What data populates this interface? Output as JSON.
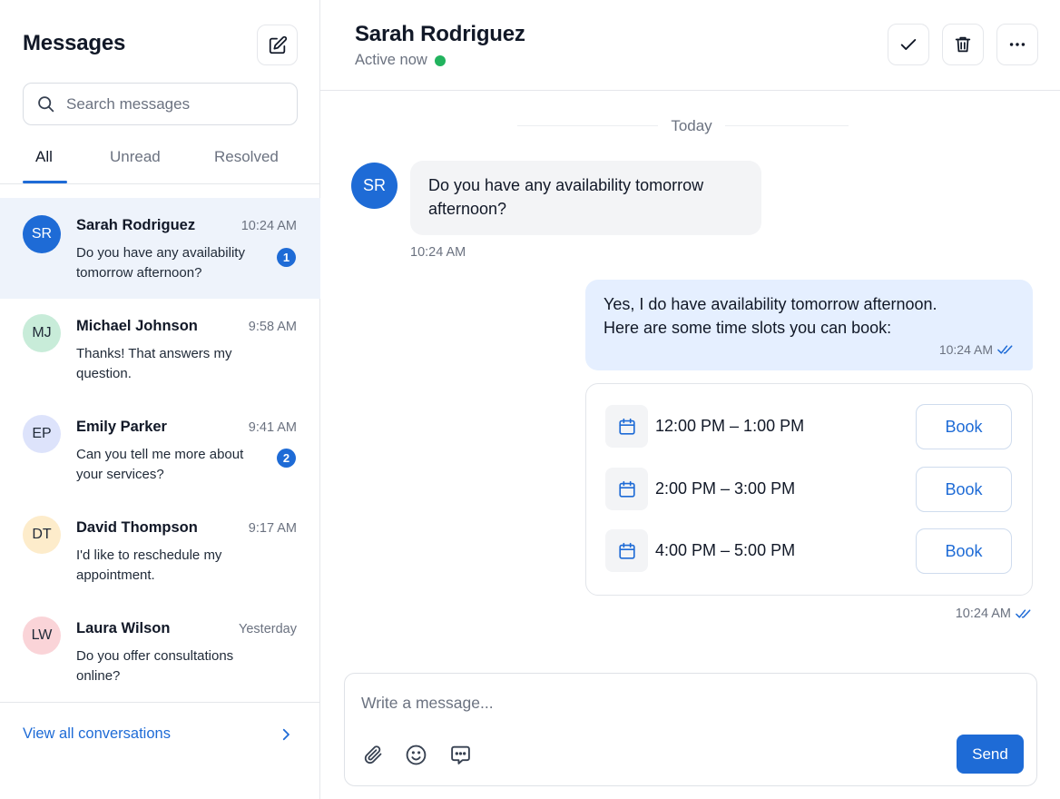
{
  "sidebar": {
    "title": "Messages",
    "search_placeholder": "Search messages",
    "tabs": [
      {
        "label": "All",
        "active": true
      },
      {
        "label": "Unread",
        "active": false
      },
      {
        "label": "Resolved",
        "active": false
      }
    ],
    "conversations": [
      {
        "initials": "SR",
        "name": "Sarah Rodriguez",
        "time": "10:24 AM",
        "preview": "Do you have any availability tomorrow afternoon?",
        "unread": "1",
        "selected": true,
        "avatar_bg": "#1e6bd6",
        "avatar_fg": "#ffffff"
      },
      {
        "initials": "MJ",
        "name": "Michael Johnson",
        "time": "9:58 AM",
        "preview": "Thanks! That answers my question.",
        "unread": "",
        "selected": false,
        "avatar_bg": "#c8ecd9",
        "avatar_fg": "#1f2937"
      },
      {
        "initials": "EP",
        "name": "Emily Parker",
        "time": "9:41 AM",
        "preview": "Can you tell me more about your services?",
        "unread": "2",
        "selected": false,
        "avatar_bg": "#dde3fb",
        "avatar_fg": "#1f2937"
      },
      {
        "initials": "DT",
        "name": "David Thompson",
        "time": "9:17 AM",
        "preview": "I'd like to reschedule my appointment.",
        "unread": "",
        "selected": false,
        "avatar_bg": "#fdeccb",
        "avatar_fg": "#1f2937"
      },
      {
        "initials": "LW",
        "name": "Laura Wilson",
        "time": "Yesterday",
        "preview": "Do you offer consultations online?",
        "unread": "",
        "selected": false,
        "avatar_bg": "#fad4d8",
        "avatar_fg": "#1f2937"
      }
    ],
    "view_all_label": "View all conversations"
  },
  "chat": {
    "contact_name": "Sarah Rodriguez",
    "status": "Active now",
    "day_label": "Today",
    "incoming": {
      "initials": "SR",
      "text": "Do you have any availability tomorrow afternoon?",
      "time": "10:24 AM"
    },
    "outgoing": {
      "text_line1": "Yes, I do have availability tomorrow afternoon.",
      "text_line2": "Here are some time slots you can book:",
      "time": "10:24 AM"
    },
    "slots": [
      {
        "label": "12:00 PM – 1:00 PM",
        "button": "Book"
      },
      {
        "label": "2:00 PM – 3:00 PM",
        "button": "Book"
      },
      {
        "label": "4:00 PM – 5:00 PM",
        "button": "Book"
      }
    ],
    "slots_time": "10:24 AM"
  },
  "composer": {
    "placeholder": "Write a message...",
    "send_label": "Send"
  },
  "icons": {
    "compose": "compose-icon",
    "search": "search-icon",
    "resolve": "check-icon",
    "delete": "trash-icon",
    "more": "more-horizontal-icon",
    "calendar": "calendar-icon",
    "read_receipt": "double-check-icon",
    "attach": "paperclip-icon",
    "emoji": "emoji-icon",
    "quick_reply": "message-dots-icon",
    "chevron": "chevron-right-icon"
  },
  "colors": {
    "accent": "#1e6bd6",
    "online": "#22b35e",
    "outgoing_bubble": "#e5efff",
    "incoming_bubble": "#f3f4f6",
    "selected_row": "#eef3fb"
  }
}
